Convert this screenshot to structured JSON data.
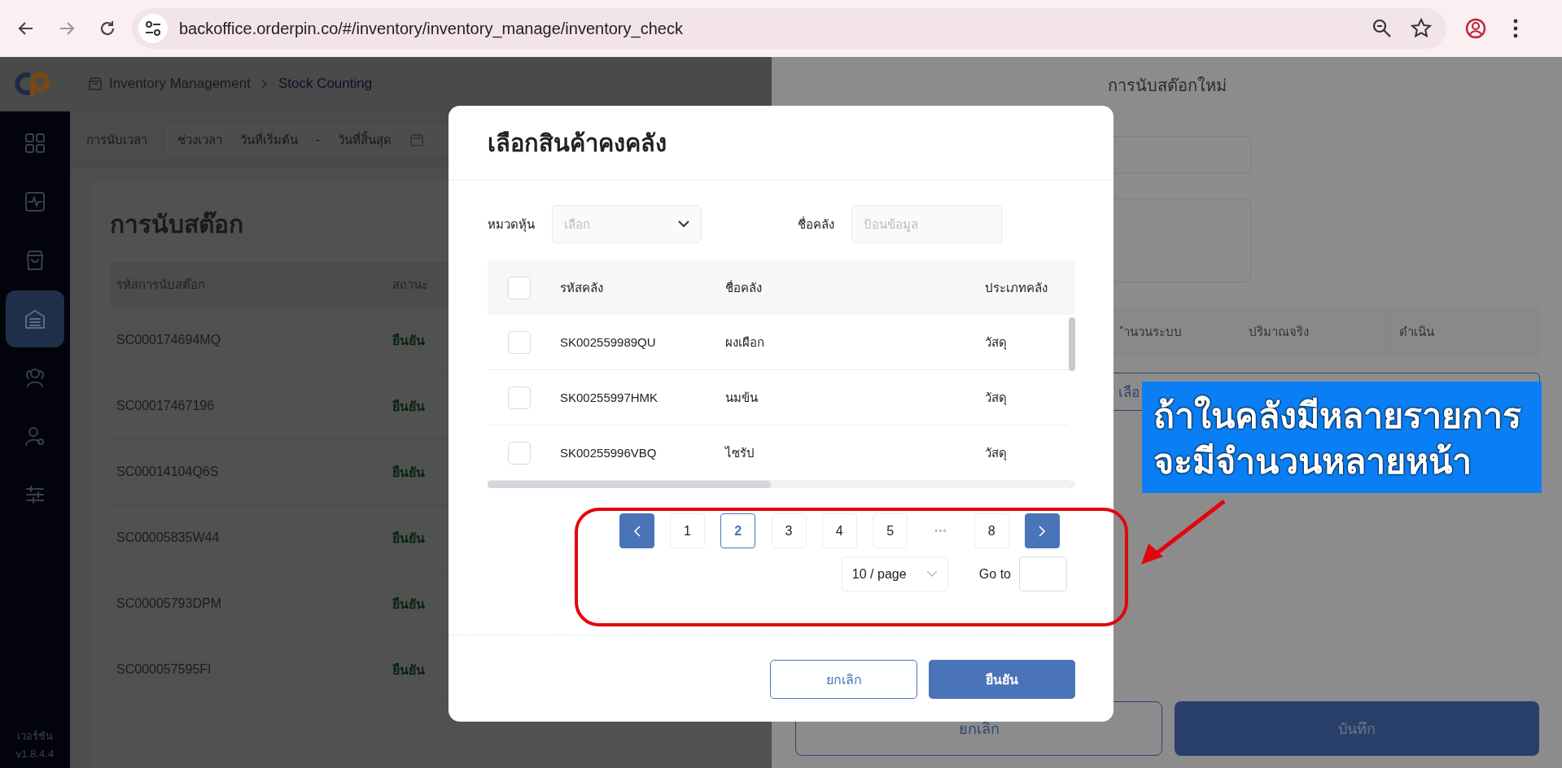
{
  "browser": {
    "url": "backoffice.orderpin.co/#/inventory/inventory_manage/inventory_check"
  },
  "sidebar": {
    "items": [
      {
        "selected": false
      },
      {
        "selected": false
      },
      {
        "selected": false
      },
      {
        "selected": true
      },
      {
        "selected": false
      },
      {
        "selected": false
      },
      {
        "selected": false
      }
    ],
    "version_label": "เวอร์ชัน",
    "version": "v1.8.4.4"
  },
  "breadcrumb": [
    "Inventory Management",
    "Stock Counting"
  ],
  "filter": {
    "label": "การนับเวลา",
    "range_label": "ช่วงเวลา",
    "start_placeholder": "วันที่เริ่มต้น",
    "separator": "-",
    "end_placeholder": "วันที่สิ้นสุด"
  },
  "page": {
    "title": "การนับสต๊อก",
    "table": {
      "columns": [
        "รหัสการนับสต๊อก",
        "สถานะ"
      ],
      "rows": [
        {
          "code": "SC000174694MQ",
          "status": "ยืนยัน"
        },
        {
          "code": "SC00017467196",
          "status": "ยืนยัน"
        },
        {
          "code": "SC00014104Q6S",
          "status": "ยืนยัน"
        },
        {
          "code": "SC00005835W44",
          "status": "ยืนยัน"
        },
        {
          "code": "SC00005793DPM",
          "status": "ยืนยัน"
        },
        {
          "code": "SC000057595FI",
          "status": "ยืนยัน"
        }
      ]
    }
  },
  "drawer": {
    "title": "การนับสต๊อกใหม่",
    "table": {
      "columns": [
        "ำนวนระบบ",
        "ปริมาณจริง",
        "ดำเนิน"
      ]
    },
    "select_button": "เลือ",
    "cancel_button": "ยกเลิก",
    "save_button": "บันทึก"
  },
  "modal": {
    "title": "เลือกสินค้าคงคลัง",
    "filters": [
      {
        "kind": "select",
        "label": "หมวดหุ้น",
        "placeholder": "เลือก"
      },
      {
        "kind": "input",
        "label": "ชื่อคลัง",
        "placeholder": "ป้อนข้อมูล"
      }
    ],
    "table": {
      "header_checked": false,
      "columns": [
        "รหัสคลัง",
        "ชื่อคลัง",
        "ประเภทคลัง"
      ],
      "rows": [
        {
          "checked": false,
          "code": "SK002559989QU",
          "name": "ผงเผือก",
          "type": "วัสดุ"
        },
        {
          "checked": false,
          "code": "SK00255997HMK",
          "name": "นมข้น",
          "type": "วัสดุ"
        },
        {
          "checked": false,
          "code": "SK00255996VBQ",
          "name": "ไซรัป",
          "type": "วัสดุ"
        }
      ]
    },
    "pagination": {
      "pages": [
        {
          "kind": "prev"
        },
        {
          "kind": "page",
          "label": "1",
          "selected": false
        },
        {
          "kind": "page",
          "label": "2",
          "selected": true
        },
        {
          "kind": "page",
          "label": "3",
          "selected": false
        },
        {
          "kind": "page",
          "label": "4",
          "selected": false
        },
        {
          "kind": "page",
          "label": "5",
          "selected": false
        },
        {
          "kind": "ellipsis",
          "label": "•••"
        },
        {
          "kind": "page",
          "label": "8",
          "selected": false
        },
        {
          "kind": "next"
        }
      ],
      "page_size": "10 / page",
      "goto_label": "Go to"
    },
    "cancel_button": "ยกเลิก",
    "confirm_button": "ยืนยัน"
  },
  "annotation": {
    "lines": [
      "ถ้าในคลังมีหลายรายการ",
      "จะมีจำนวนหลายหน้า"
    ]
  }
}
